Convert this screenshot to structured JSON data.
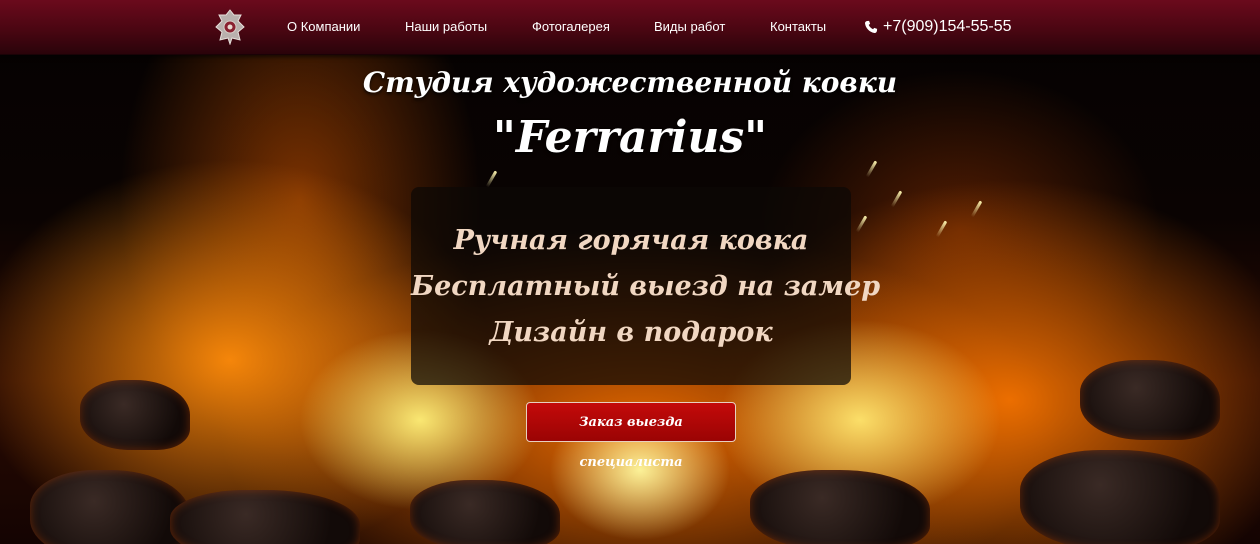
{
  "nav": {
    "items": [
      {
        "label": "О Компании"
      },
      {
        "label": "Наши работы"
      },
      {
        "label": "Фотогалерея"
      },
      {
        "label": "Виды работ"
      },
      {
        "label": "Контакты"
      }
    ],
    "phone": "+7(909)154-55-55",
    "phone_icon": "phone-icon",
    "logo_icon": "emblem-icon"
  },
  "hero": {
    "title_line1": "Студия художественной ковки",
    "title_line2": "\"Ferrarius\"",
    "features": [
      "Ручная горячая ковка",
      "Бесплатный выезд на замер",
      "Дизайн в подарок"
    ],
    "cta_label": "Заказ выезда специалиста"
  },
  "colors": {
    "navbar": "#4a0612",
    "cta": "#b00808",
    "feature_text": "#f1d7c2"
  }
}
